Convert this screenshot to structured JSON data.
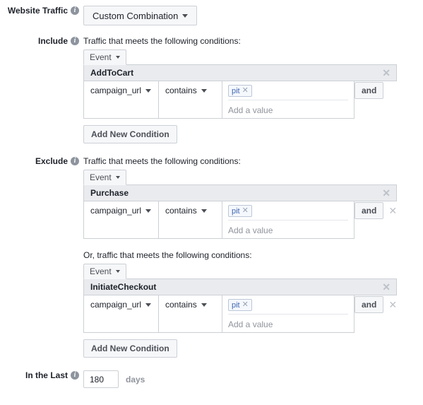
{
  "colors": {
    "accent": "#4267b2",
    "border": "#ccd0d5",
    "header_bg": "#e9ebee",
    "button_bg": "#f6f7f9",
    "muted_text": "#90949c",
    "text": "#1d2129"
  },
  "website_traffic": {
    "label": "Website Traffic",
    "info_icon": "info-icon",
    "dropdown_value": "Custom Combination",
    "caret_icon": "chevron-down-icon"
  },
  "include": {
    "label": "Include",
    "info_icon": "info-icon",
    "intro": "Traffic that meets the following conditions:",
    "groups": [
      {
        "tab_label": "Event",
        "tab_caret_icon": "chevron-down-icon",
        "event_name": "AddToCart",
        "close_icon": "close-icon",
        "field": "campaign_url",
        "field_caret_icon": "chevron-down-icon",
        "operator": "contains",
        "operator_caret_icon": "chevron-down-icon",
        "tokens": [
          "pit"
        ],
        "token_remove_icon": "close-icon",
        "value_placeholder": "Add a value",
        "and_label": "and",
        "has_group_remove": false
      }
    ],
    "add_condition_label": "Add New Condition"
  },
  "exclude": {
    "label": "Exclude",
    "info_icon": "info-icon",
    "intro": "Traffic that meets the following conditions:",
    "or_intro": "Or, traffic that meets the following conditions:",
    "groups": [
      {
        "tab_label": "Event",
        "tab_caret_icon": "chevron-down-icon",
        "event_name": "Purchase",
        "close_icon": "close-icon",
        "field": "campaign_url",
        "field_caret_icon": "chevron-down-icon",
        "operator": "contains",
        "operator_caret_icon": "chevron-down-icon",
        "tokens": [
          "pit"
        ],
        "token_remove_icon": "close-icon",
        "value_placeholder": "Add a value",
        "and_label": "and",
        "has_group_remove": true,
        "group_remove_icon": "close-icon"
      },
      {
        "tab_label": "Event",
        "tab_caret_icon": "chevron-down-icon",
        "event_name": "InitiateCheckout",
        "close_icon": "close-icon",
        "field": "campaign_url",
        "field_caret_icon": "chevron-down-icon",
        "operator": "contains",
        "operator_caret_icon": "chevron-down-icon",
        "tokens": [
          "pit"
        ],
        "token_remove_icon": "close-icon",
        "value_placeholder": "Add a value",
        "and_label": "and",
        "has_group_remove": true,
        "group_remove_icon": "close-icon"
      }
    ],
    "add_condition_label": "Add New Condition"
  },
  "in_the_last": {
    "label": "In the Last",
    "info_icon": "info-icon",
    "value": "180",
    "unit": "days"
  }
}
